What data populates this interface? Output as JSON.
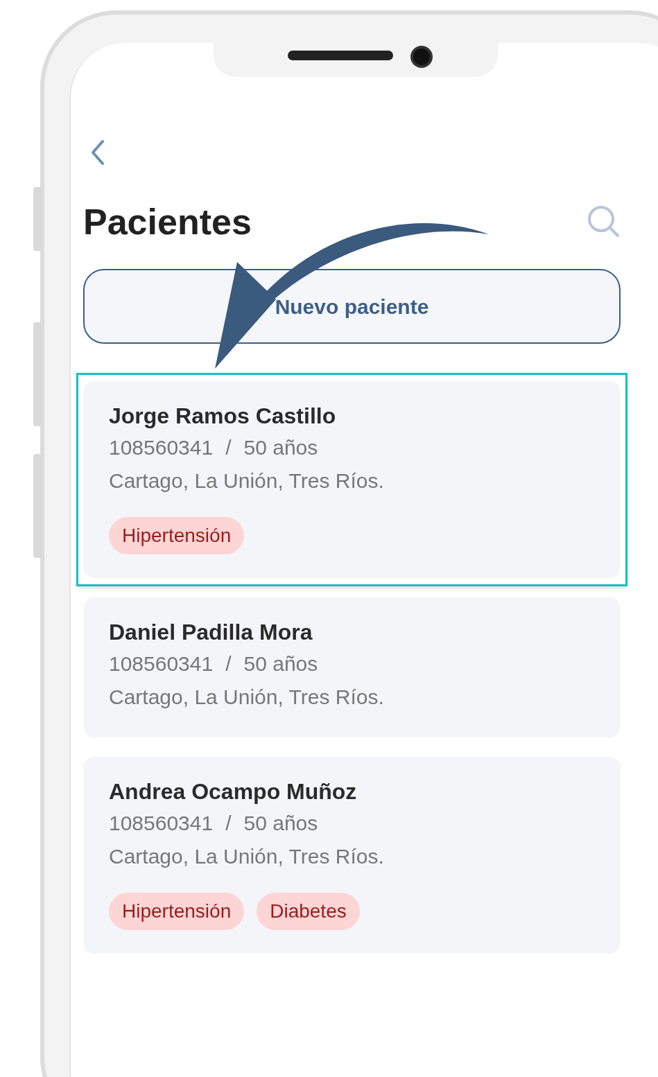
{
  "screen": {
    "title": "Pacientes"
  },
  "new_patient_button": {
    "label": "Nuevo paciente"
  },
  "patients": [
    {
      "name": "Jorge Ramos Castillo",
      "id_number": "108560341",
      "separator": "/",
      "age": "50 años",
      "address": "Cartago, La Unión, Tres Ríos.",
      "tags": [
        "Hipertensión"
      ],
      "highlighted": true
    },
    {
      "name": "Daniel Padilla Mora",
      "id_number": "108560341",
      "separator": "/",
      "age": "50 años",
      "address": "Cartago, La Unión, Tres Ríos.",
      "highlighted": false
    },
    {
      "name": "Andrea Ocampo Muñoz",
      "id_number": "108560341",
      "separator": "/",
      "age": "50 años",
      "address": "Cartago, La Unión, Tres Ríos.",
      "tags": [
        "Hipertensión",
        "Diabetes"
      ],
      "highlighted": false
    }
  ]
}
